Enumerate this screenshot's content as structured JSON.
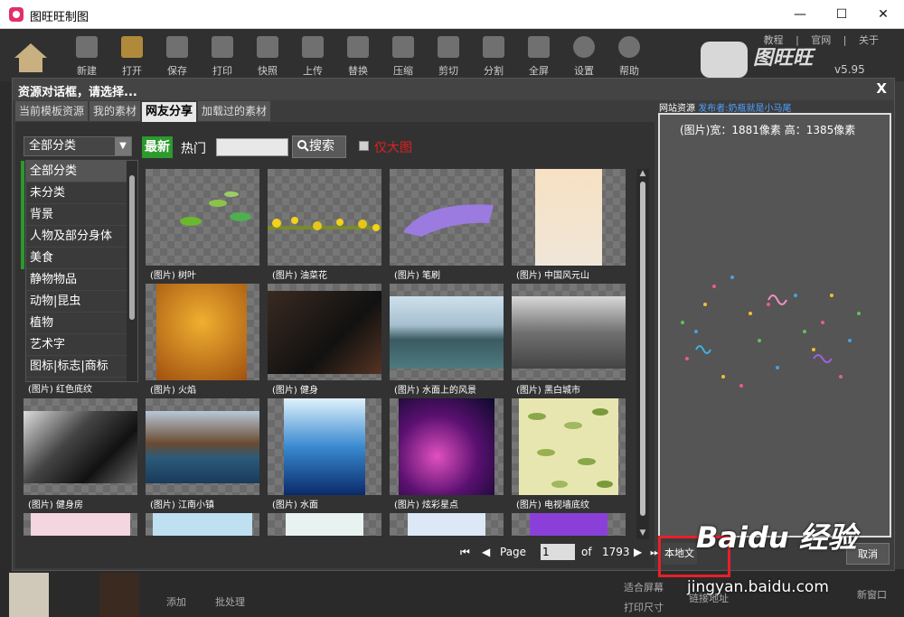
{
  "window": {
    "title": "图旺旺制图",
    "min": "—",
    "max": "☐",
    "close": "✕"
  },
  "toolbar": {
    "buttons": [
      "新建",
      "打开",
      "保存",
      "打印",
      "快照",
      "上传",
      "替换",
      "压缩",
      "剪切",
      "分割",
      "全屏",
      "设置",
      "帮助"
    ],
    "links": [
      "教程",
      "官网",
      "关于"
    ],
    "brand_name": "图旺旺",
    "version": "v5.95"
  },
  "dialog": {
    "title": "资源对话框，请选择...",
    "close": "X",
    "tabs": [
      "当前模板资源",
      "我的素材",
      "网友分享",
      "加载过的素材"
    ],
    "active_tab": "网友分享",
    "website_label": "网站资源",
    "publisher": "发布者:奶瓶就是小马尾",
    "category_select": "全部分类",
    "newest_label": "最新",
    "hot_label": "热门",
    "search_label": "搜索",
    "large_only_label": "仅大图",
    "categories": [
      "全部分类",
      "未分类",
      "背景",
      "人物及部分身体",
      "美食",
      "静物物品",
      "动物|昆虫",
      "植物",
      "艺术字",
      "图标|标志|商标"
    ],
    "items": [
      {
        "caption": "(图片) 树叶"
      },
      {
        "caption": "(图片) 油菜花"
      },
      {
        "caption": "(图片) 笔刷"
      },
      {
        "caption": "(图片) 中国风元山"
      },
      {
        "caption": "(图片) 红色底纹"
      },
      {
        "caption": "(图片) 火焰"
      },
      {
        "caption": "(图片) 健身"
      },
      {
        "caption": "(图片) 水面上的风景"
      },
      {
        "caption": "(图片) 黑白城市"
      },
      {
        "caption": "(图片) 健身房"
      },
      {
        "caption": "(图片) 江南小镇"
      },
      {
        "caption": "(图片) 水面"
      },
      {
        "caption": "(图片) 炫彩星点"
      },
      {
        "caption": "(图片) 电视墙底纹"
      },
      {
        "caption": ""
      },
      {
        "caption": ""
      },
      {
        "caption": ""
      },
      {
        "caption": ""
      },
      {
        "caption": ""
      }
    ],
    "pager": {
      "page_label": "Page",
      "current": "1",
      "of_label": "of",
      "total": "1793"
    },
    "preview_dims": "(图片)宽：1881像素  高：1385像素",
    "local_file_label": "本地文",
    "cancel_label": "取消"
  },
  "background": {
    "bottom_items": [
      "添加",
      "批处理",
      "适合屏幕",
      "打印尺寸",
      "链接地址",
      "新窗口"
    ]
  },
  "watermark": {
    "logo": "Baidu 经验",
    "url": "jingyan.baidu.com"
  },
  "colors": {
    "accent_green": "#2c9a2c",
    "red_text": "#e02020",
    "publisher_blue": "#4fa0ff",
    "highlight_red": "#e8202a"
  }
}
